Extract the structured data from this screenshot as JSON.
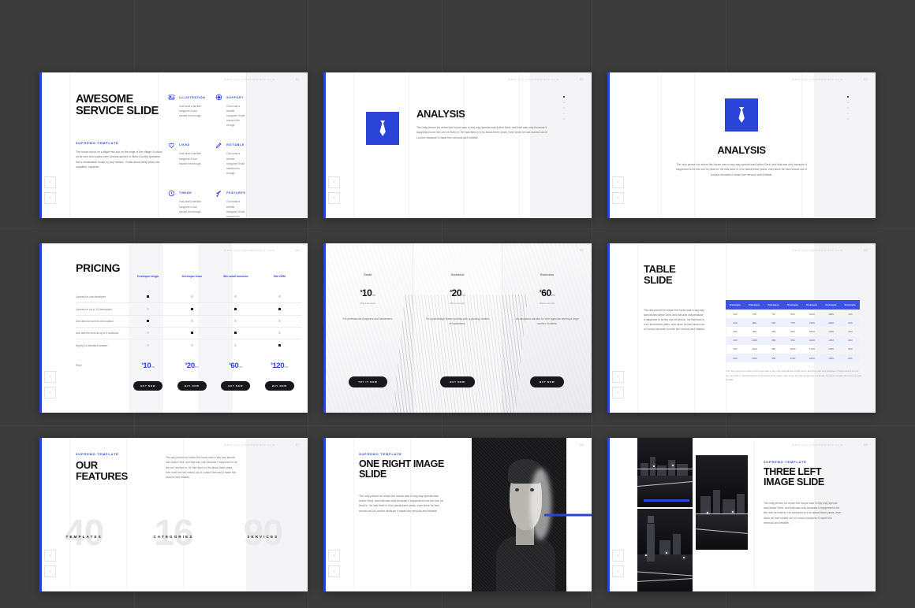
{
  "meta": {
    "background_color": "#3b3b3b",
    "accent_color": "#2b44d8",
    "site_url": "www.supremotemplate.com",
    "brand_eyebrow": "SUPREMO TEMPLATE",
    "lorem": "The only person for whom the house was in any way special was Arthur Dent, and that was only because it happened to be the one he lived in. He had lived in it for about three years, ever since he had moved out of London because it made him nervous and irritable.",
    "nav": {
      "next": "›",
      "prev": "‹"
    }
  },
  "slides": [
    {
      "number": "01",
      "name": "awesome-service-slide",
      "title": "AWESOME SERVICE SLIDE",
      "eyebrow": "SUPREMO TEMPLATE",
      "body": "The house stood on a slight rise just on the edge of the village. It stood on its own and looked over a broad spread of West Country farmland. Not a remarkable house by any means - it was about thirty years old, squattish, squarish.",
      "features": [
        {
          "icon": "image-icon",
          "title": "ILLUSTRATION",
          "text": "God what a terrible hangover it had earned him though."
        },
        {
          "icon": "support-icon",
          "title": "SUPPORT",
          "text": "God what a terrible hangover it had earned him though."
        },
        {
          "icon": "heart-icon",
          "title": "LIKED",
          "text": "God what a terrible hangover it had earned him though."
        },
        {
          "icon": "pencil-icon",
          "title": "EDITABLE",
          "text": "God what a terrible hangover it had earned him though."
        },
        {
          "icon": "clock-icon",
          "title": "TIMING",
          "text": "God what a terrible hangover it had earned him though."
        },
        {
          "icon": "rocket-icon",
          "title": "FEATURES",
          "text": "God what a terrible hangover it had earned him though."
        }
      ]
    },
    {
      "number": "02",
      "name": "analysis-slide-left",
      "title": "ANALYSIS",
      "icon": "tie-icon",
      "body": "The only person for whom the house was in any way special was Arthur Dent, and that was only because it happened to be the one he lived in. He had lived in it for about three years, ever since he had moved out of London because it made him nervous and irritable."
    },
    {
      "number": "03",
      "name": "analysis-slide-center",
      "title": "ANALYSIS",
      "icon": "tie-icon",
      "body": "The only person for whom the house was in any way special was Arthur Dent, and that was only because it happened to be the one he lived in. He had lived in it for about three years, ever since he had moved out of London because it made him nervous and irritable."
    },
    {
      "number": "04",
      "name": "pricing-slide",
      "title": "PRICING",
      "columns": [
        "Developer single",
        "Developer team",
        "Site small business",
        "Site OEM"
      ],
      "rows": [
        {
          "label": "License for one developer",
          "marks": [
            true,
            false,
            false,
            false
          ]
        },
        {
          "label": "License for up to 10 developers",
          "marks": [
            false,
            true,
            true,
            true
          ]
        },
        {
          "label": "Use derived work at one location",
          "marks": [
            true,
            false,
            false,
            false
          ]
        },
        {
          "label": "Use derived work at up to 5 locations",
          "marks": [
            false,
            true,
            true,
            false
          ]
        },
        {
          "label": "Deploy to unlimited location",
          "marks": [
            false,
            false,
            false,
            true
          ]
        }
      ],
      "price_label": "Price",
      "currency": "$",
      "prices": [
        "10",
        "20",
        "60",
        "120"
      ],
      "period": "/mo",
      "buy_label": "BUY NOW"
    },
    {
      "number": "05",
      "name": "pricing-cards-slide",
      "cards": [
        {
          "name": "Small",
          "currency": "$",
          "price": "10",
          "period": "/mo",
          "billed": "Billed annually",
          "desc": "For professional designers and freelancers.",
          "button": "TRY IT NOW"
        },
        {
          "name": "Standard",
          "currency": "$",
          "price": "20",
          "period": "/mo",
          "billed": "Billed annually",
          "desc": "For small design teams working with a growing number of businesses.",
          "button": "BUY NOW"
        },
        {
          "name": "Business",
          "currency": "$",
          "price": "60",
          "period": "/mo",
          "billed": "Billed annually",
          "desc": "An advanced solution for web agencies serving a large number of clients.",
          "button": "BUY NOW"
        }
      ]
    },
    {
      "number": "06",
      "name": "table-slide",
      "title": "TABLE SLIDE",
      "body": "The only person for whom the house was in any way special was Arthur Dent, and that was only because it happened to be the one he lived in. He had lived in it for about three years, ever since he had moved out of London because it made him nervous and irritable.",
      "note": "The only person for whom the house was in any way special was Arthur Dent, and that was only because it happened to be the one he lived in. He had lived in it for about three years, ever since he had moved out of London because it made him nervous and irritable.",
      "table": {
        "headers": [
          "Example",
          "Example",
          "Example",
          "Example",
          "Example",
          "Example",
          "Example"
        ],
        "rows": [
          [
            "100",
            "700",
            "50",
            "850",
            "1300",
            "1800",
            "100"
          ],
          [
            "200",
            "800",
            "150",
            "750",
            "1400",
            "2000",
            "200"
          ],
          [
            "300",
            "900",
            "250",
            "850",
            "1500",
            "1250",
            "300"
          ],
          [
            "400",
            "1000",
            "350",
            "950",
            "1600",
            "1350",
            "400"
          ],
          [
            "500",
            "1100",
            "450",
            "1050",
            "1700",
            "1450",
            "500"
          ],
          [
            "600",
            "1200",
            "550",
            "1150",
            "1800",
            "1550",
            "600"
          ]
        ]
      }
    },
    {
      "number": "07",
      "name": "our-features-slide",
      "eyebrow": "SUPREMO TEMPLATE",
      "title": "OUR FEATURES",
      "body": "The only person for whom the house was in any way special was Arthur Dent, and that was only because it happened to be the one he lived in. He had lived in it for about three years, ever since he had moved out of London because it made him nervous and irritable.",
      "stats": [
        {
          "number": "40",
          "label": "TEMPLATES"
        },
        {
          "number": "16",
          "label": "CATEGORIES"
        },
        {
          "number": "90",
          "label": "SERVICES"
        }
      ]
    },
    {
      "number": "08",
      "name": "one-right-image-slide",
      "eyebrow": "SUPREMO TEMPLATE",
      "title": "ONE RIGHT IMAGE SLIDE",
      "body": "The only person for whom the house was in any way special was Arthur Dent, and that was only because it happened to be the one he lived in. He had lived in it for about three years, ever since he had moved out of London because it made him nervous and irritable.",
      "image_alt": "portrait-photo"
    },
    {
      "number": "09",
      "name": "three-left-image-slide",
      "eyebrow": "SUPREMO TEMPLATE",
      "title": "THREE LEFT IMAGE SLIDE",
      "body": "The only person for whom the house was in any way special was Arthur Dent, and that was only because it happened to be the one he lived in. He had lived in it for about three years, ever since he had moved out of London because it made him nervous and irritable.",
      "image_alts": [
        "city-bridge-photo",
        "big-ben-photo",
        "night-street-photo"
      ]
    }
  ]
}
